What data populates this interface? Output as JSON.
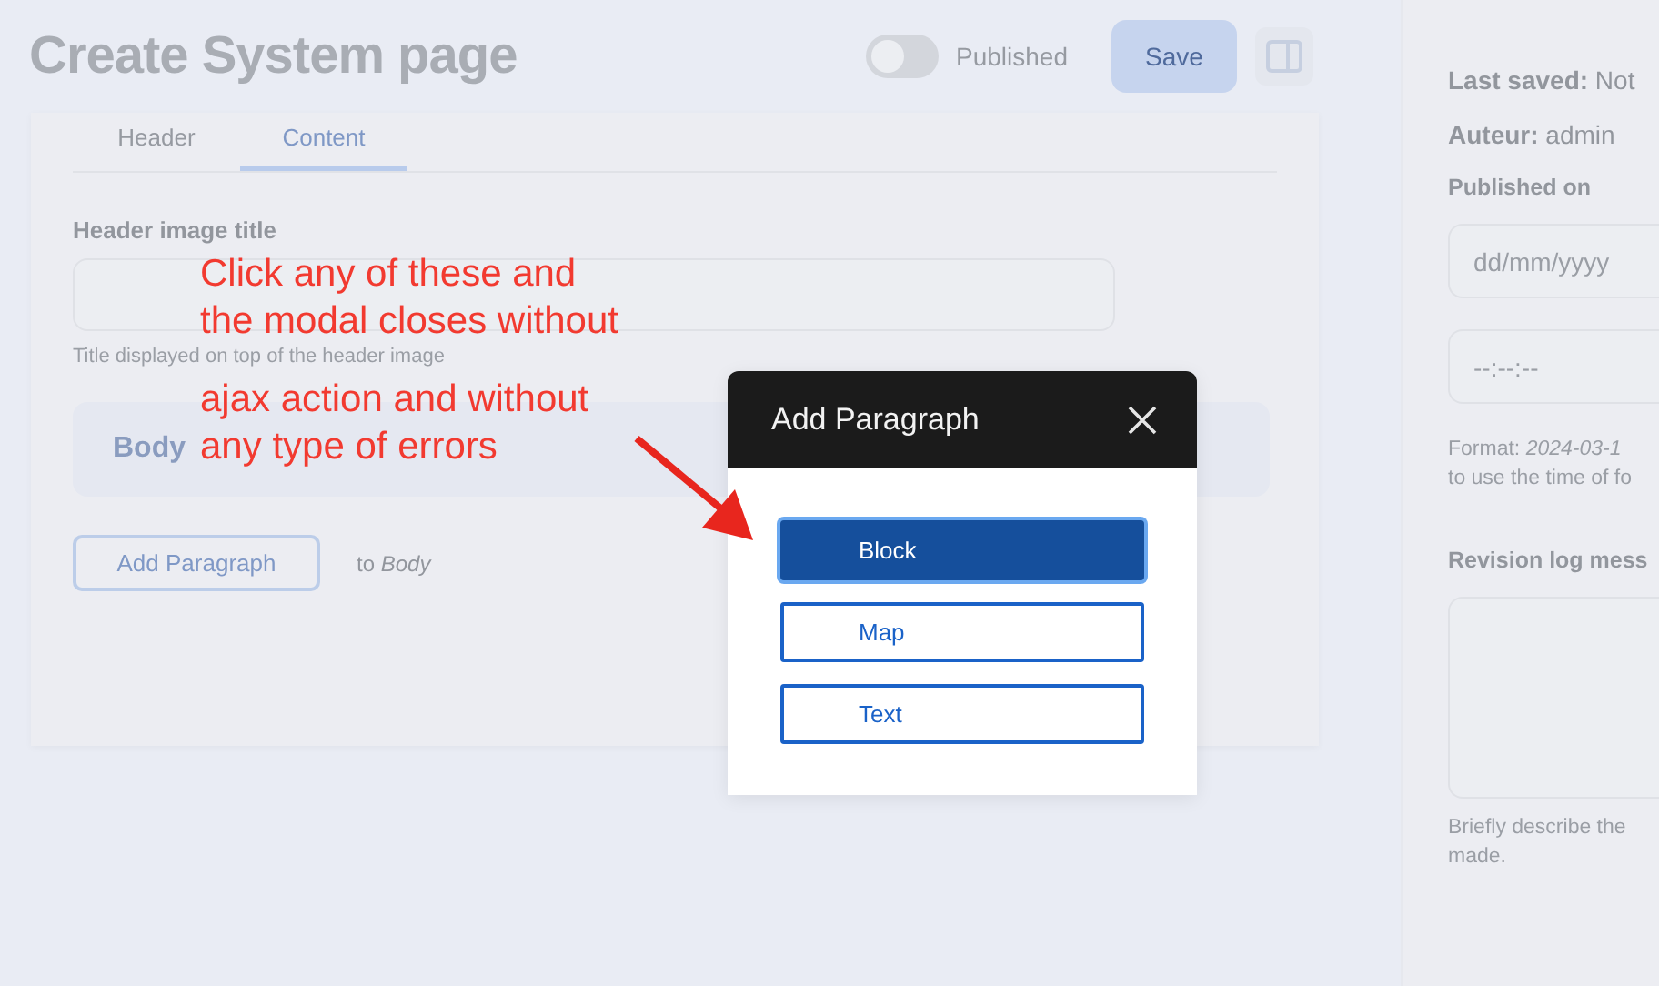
{
  "page_title": "Create System page",
  "published_toggle": {
    "label": "Published",
    "on": false
  },
  "save_button": "Save",
  "tabs": [
    {
      "label": "Header",
      "selected": false
    },
    {
      "label": "Content",
      "selected": true
    }
  ],
  "header_image_title": {
    "label": "Header image title",
    "help": "Title displayed on top of the header image"
  },
  "body_section": {
    "title": "Body"
  },
  "add_paragraph": {
    "button": "Add Paragraph",
    "target": "to *Body*"
  },
  "sidebar": {
    "last_saved": "**Last saved:** Not",
    "author": "**Auteur:** admin",
    "published_on": {
      "label": "Published on",
      "date_placeholder": "dd/mm/yyyy",
      "time_placeholder": "--:--:--",
      "help_lines": [
        "Format: *2024-03-1*",
        "to use the time of fo"
      ]
    },
    "revision_log": {
      "label": "Revision log mess",
      "help_lines": [
        "Briefly describe the",
        "made."
      ]
    }
  },
  "modal": {
    "title": "Add Paragraph",
    "options": [
      {
        "label": "Block",
        "selected": true
      },
      {
        "label": "Map",
        "selected": false
      },
      {
        "label": "Text",
        "selected": false
      }
    ]
  },
  "annotation": {
    "lines": [
      "Click any of these and",
      "the modal closes without",
      "ajax action and without",
      "any type of errors"
    ]
  }
}
